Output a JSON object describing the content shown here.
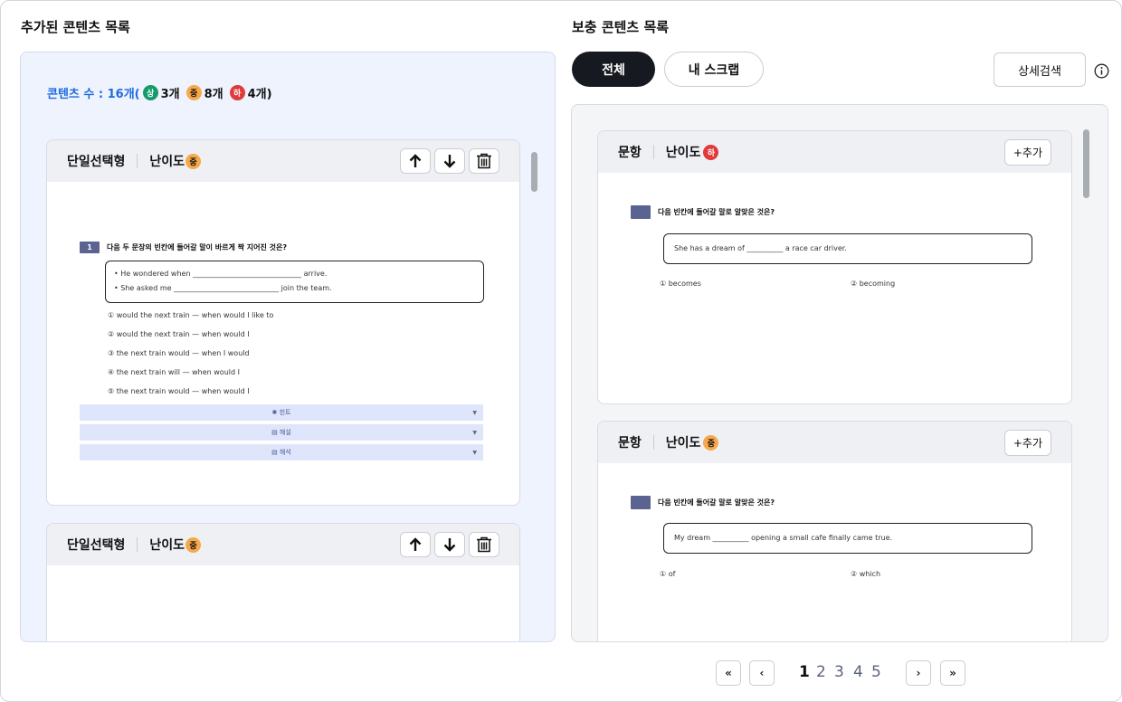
{
  "left": {
    "title": "추가된 콘텐츠 목록",
    "count": {
      "label": "콘텐츠 수 : 16개(",
      "high_icon": "상",
      "high": "3개",
      "mid_icon": "중",
      "mid": "8개",
      "low_icon": "하",
      "low": "4개)"
    },
    "cards": [
      {
        "type": "단일선택형",
        "level_label": "난이도",
        "level": "중"
      },
      {
        "type": "단일선택형",
        "level_label": "난이도",
        "level": "중"
      }
    ],
    "question": {
      "num": "1",
      "text": "다음 두 문장의 빈칸에 들어갈 말이 바르게 짝 지어진 것은?",
      "bullets": [
        "He wondered when ______________________________ arrive.",
        "She asked me _____________________________ join the team."
      ],
      "options": [
        "① would the next train — when would I like to",
        "② would the next train — when would I",
        "③ the next train would — when I would",
        "④ the next train will — when would I",
        "⑤ the next train would — when would I"
      ],
      "accordions": [
        "힌트",
        "해설",
        "해석"
      ]
    }
  },
  "right": {
    "title": "보충 콘텐츠 목록",
    "tabs": [
      "전체",
      "내 스크랩"
    ],
    "search_button": "상세검색",
    "cards": [
      {
        "type": "문항",
        "level_label": "난이도",
        "level": "하",
        "add": "+추가",
        "q": "다음 빈칸에 들어갈 말로 알맞은 것은?",
        "sentence": "She has a dream of __________ a race car driver.",
        "opt1": "① becomes",
        "opt2": "② becoming"
      },
      {
        "type": "문항",
        "level_label": "난이도",
        "level": "중",
        "add": "+추가",
        "q": "다음 빈칸에 들어갈 말로 알맞은 것은?",
        "sentence": "My dream __________ opening a small cafe finally came true.",
        "opt1": "① of",
        "opt2": "② which"
      }
    ]
  },
  "pagination": {
    "pages": [
      "1",
      "2",
      "3",
      "4",
      "5"
    ],
    "current": "1",
    "first": "«",
    "prev": "‹",
    "next": "›",
    "last": "»"
  },
  "colors": {
    "accent_blue": "#1f6ae0",
    "level_high": "#159a6c",
    "level_mid": "#f7a84a",
    "level_low": "#e03a3a",
    "active_tab": "#16191f"
  }
}
